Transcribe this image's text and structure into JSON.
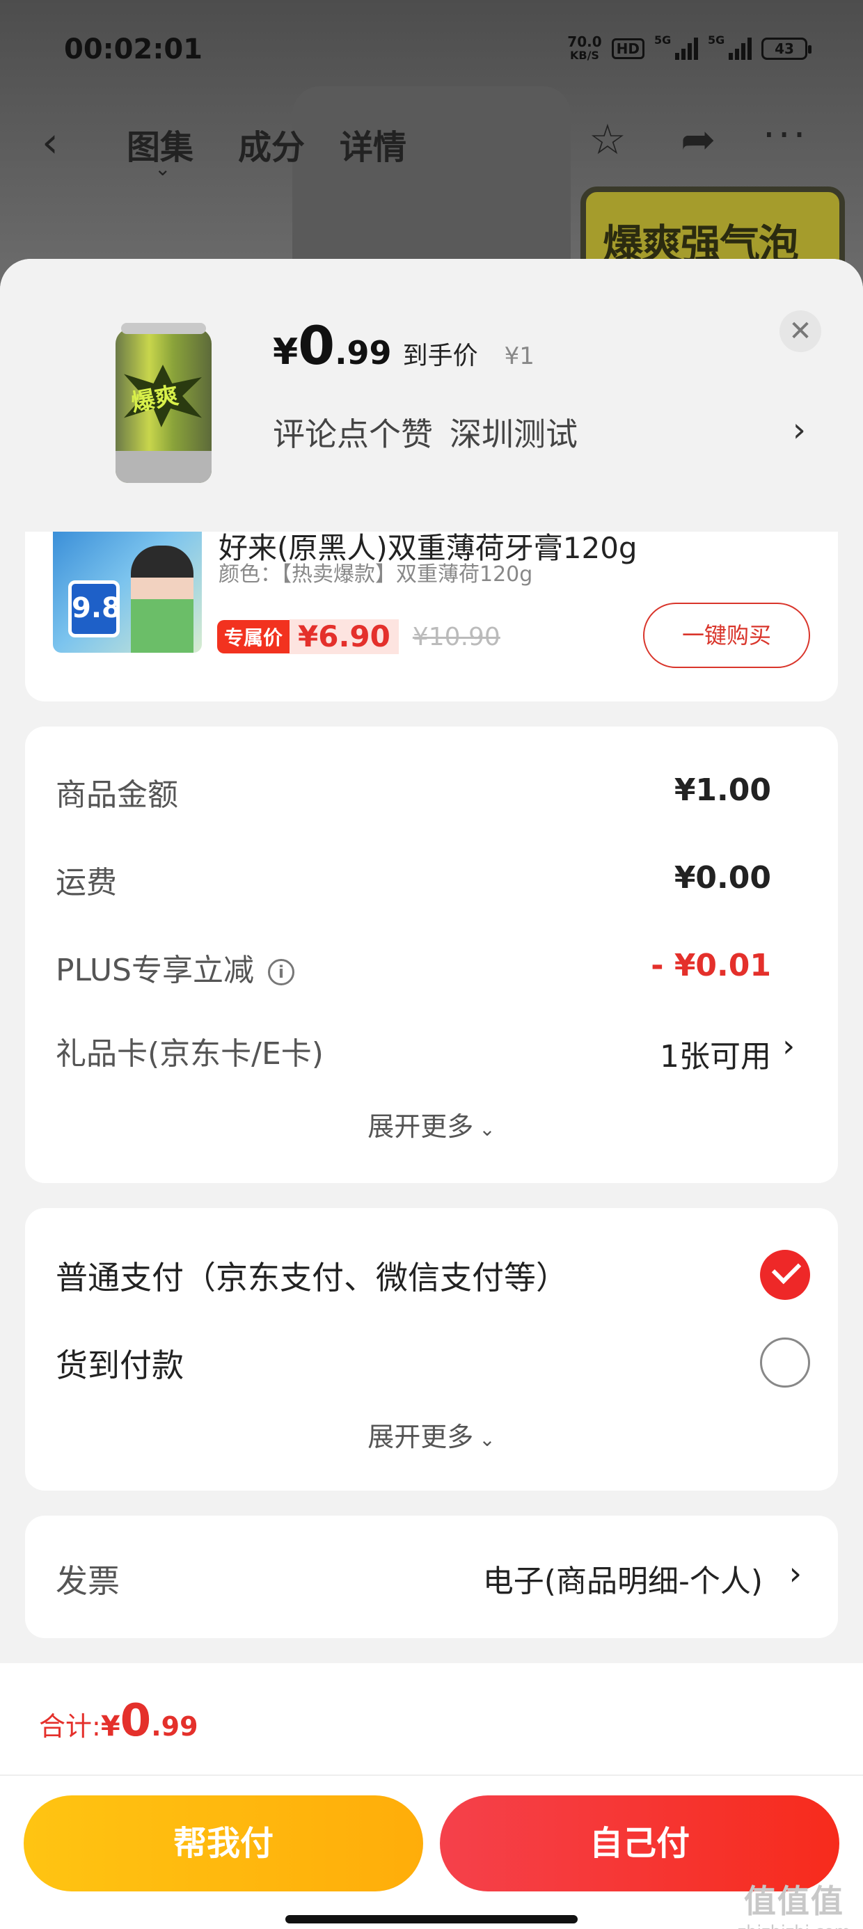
{
  "status_bar": {
    "time": "00:02:01",
    "net_speed_value": "70.0",
    "net_speed_unit": "KB/S",
    "hd_label": "HD",
    "sim1_label": "5G",
    "sim2_label": "5G",
    "battery": "43"
  },
  "nav": {
    "tabs": [
      "图集",
      "成分",
      "详情"
    ],
    "active_tab_index": 0,
    "banner_text": "爆爽强气泡"
  },
  "sheet_header": {
    "price_currency": "¥",
    "price_int": "0",
    "price_dec": ".99",
    "price_label": "到手价",
    "original_price": "¥1",
    "promo_1": "评论点个赞",
    "promo_2": "深圳测试",
    "product_image_icon": "soda-can-image",
    "product_can_text": "爆爽"
  },
  "recommendation": {
    "title": "好来(原黑人)双重薄荷牙膏120g",
    "spec": "颜色：【热卖爆款】双重薄荷120g",
    "tag": "专属价",
    "price": "¥6.90",
    "original_price": "¥10.90",
    "buy_label": "一键购买",
    "image_badge": "9.8"
  },
  "fees": {
    "rows": [
      {
        "label": "商品金额",
        "value": "¥1.00"
      },
      {
        "label": "运费",
        "value": "¥0.00"
      },
      {
        "label": "PLUS专享立减",
        "value": "- ¥0.01"
      },
      {
        "label": "礼品卡(京东卡/E卡)",
        "value": "1张可用"
      }
    ],
    "expand_label": "展开更多"
  },
  "payment": {
    "options": [
      {
        "label": "普通支付（京东支付、微信支付等）",
        "selected": true
      },
      {
        "label": "货到付款",
        "selected": false
      }
    ],
    "expand_label": "展开更多"
  },
  "invoice": {
    "label": "发票",
    "value": "电子(商品明细-个人)"
  },
  "footer": {
    "total_label": "合计:",
    "total_currency": "¥",
    "total_int": "0",
    "total_dec": ".99",
    "help_pay_label": "帮我付",
    "self_pay_label": "自己付"
  },
  "watermark": {
    "logo": "值值值",
    "site": "zhizhizhi.com"
  },
  "colors": {
    "accent_red": "#e4302b",
    "pay_yellow": "#ffc412",
    "pay_red": "#f5414b"
  }
}
